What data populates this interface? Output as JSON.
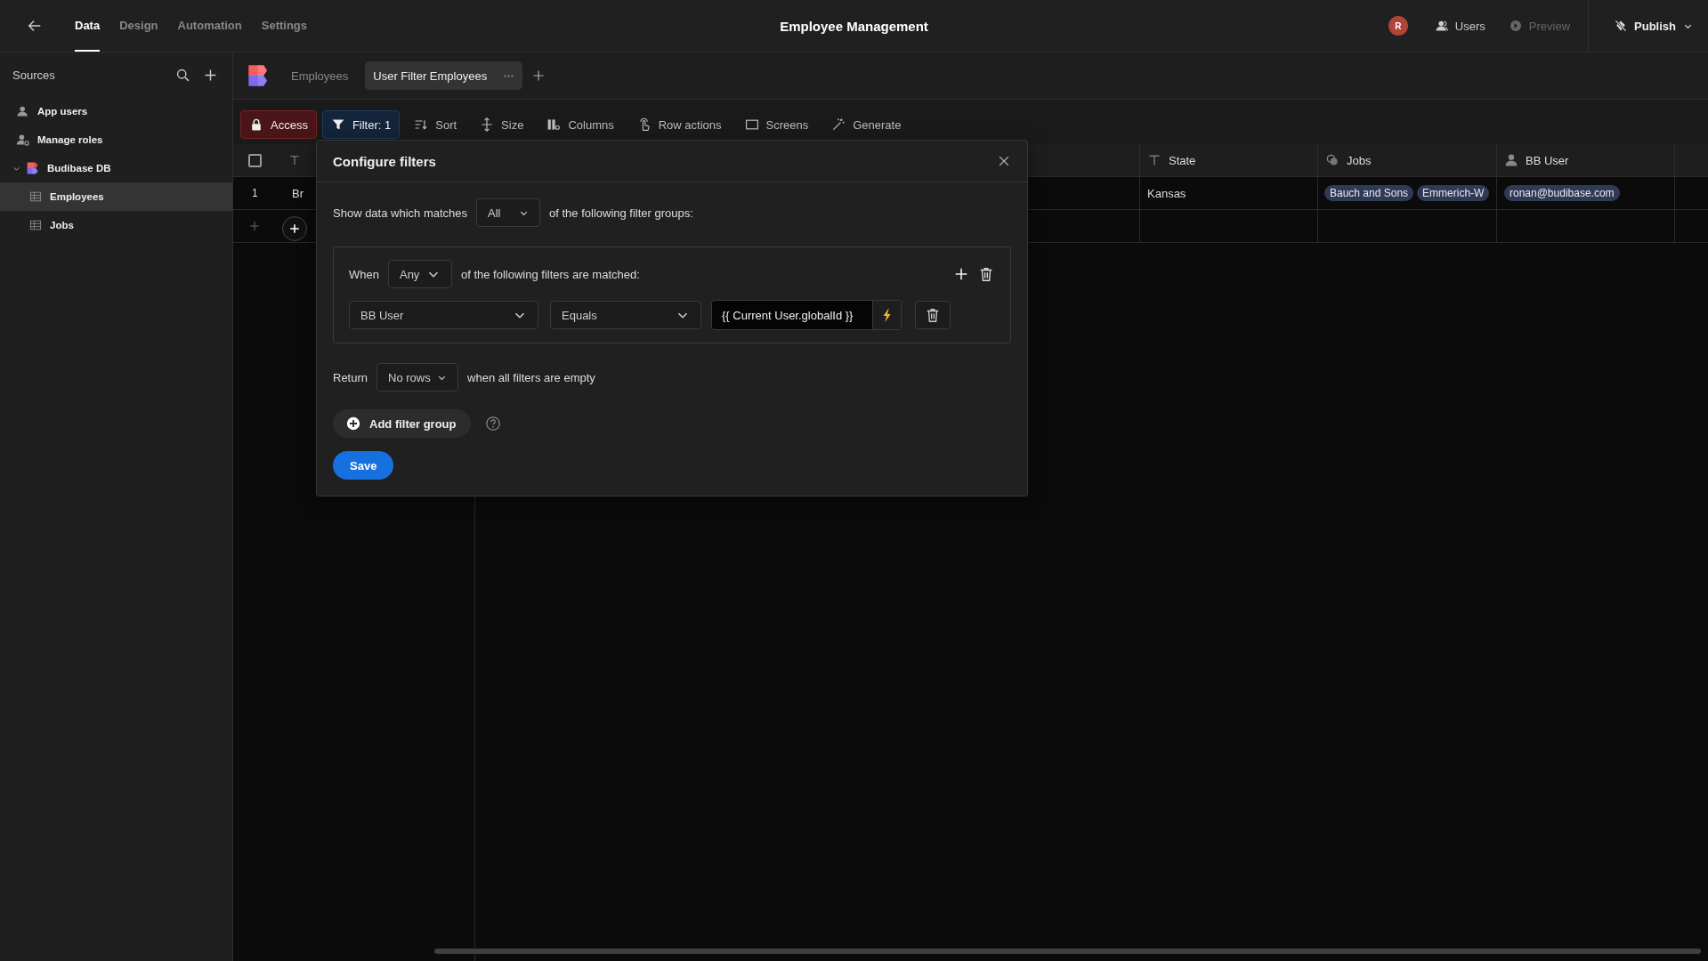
{
  "top_nav": {
    "tabs": [
      {
        "label": "Data",
        "selected": true
      },
      {
        "label": "Design",
        "selected": false
      },
      {
        "label": "Automation",
        "selected": false
      },
      {
        "label": "Settings",
        "selected": false
      }
    ],
    "title": "Employee Management",
    "avatar": "R",
    "actions": [
      {
        "label": "Users",
        "kind": "users",
        "disabled": false
      },
      {
        "label": "Preview",
        "kind": "preview",
        "disabled": true
      }
    ],
    "publish": "Publish"
  },
  "sidebar": {
    "title": "Sources",
    "items": [
      {
        "label": "App users",
        "kind": "users"
      },
      {
        "label": "Manage roles",
        "kind": "roles"
      },
      {
        "label": "Budibase DB",
        "kind": "database",
        "expanded": true,
        "children": [
          {
            "label": "Employees",
            "selected": true
          },
          {
            "label": "Jobs",
            "selected": false
          }
        ]
      }
    ]
  },
  "tab_bar": {
    "tabs": [
      {
        "label": "Employees",
        "selected": false
      },
      {
        "label": "User Filter Employees",
        "selected": true
      }
    ]
  },
  "toolbar": [
    {
      "label": "Access",
      "kind": "access"
    },
    {
      "label": "Filter: 1",
      "kind": "filter"
    },
    {
      "label": "Sort",
      "kind": "sort"
    },
    {
      "label": "Size",
      "kind": "size"
    },
    {
      "label": "Columns",
      "kind": "columns"
    },
    {
      "label": "Row actions",
      "kind": "row-actions"
    },
    {
      "label": "Screens",
      "kind": "screens"
    },
    {
      "label": "Generate",
      "kind": "generate"
    }
  ],
  "table": {
    "select_all_checked": false,
    "columns": [
      {
        "label": "State",
        "kind": "text"
      },
      {
        "label": "Jobs",
        "kind": "link"
      },
      {
        "label": "BB User",
        "kind": "user"
      }
    ],
    "rows": [
      {
        "number": "1",
        "column_1": "Br",
        "cells": [
          {
            "kind": "text",
            "value": "Kansas"
          },
          {
            "kind": "tags",
            "tags": [
              "Bauch and Sons",
              "Emmerich-W"
            ]
          },
          {
            "kind": "tags",
            "tags": [
              "ronan@budibase.com"
            ]
          }
        ]
      }
    ]
  },
  "filter_dialog": {
    "title": "Configure filters",
    "match_prefix": "Show data which matches",
    "match_value": "All",
    "match_suffix": "of the following filter groups:",
    "groups": [
      {
        "when_label": "When",
        "match_value": "Any",
        "match_suffix": "of the following filters are matched:",
        "filters": [
          {
            "field": "BB User",
            "operator": "Equals",
            "value": "{{ Current User.globalId }}"
          }
        ]
      }
    ],
    "return_label": "Return",
    "return_value": "No rows",
    "return_suffix": "when all filters are empty",
    "add_group": "Add filter group",
    "save": "Save"
  }
}
